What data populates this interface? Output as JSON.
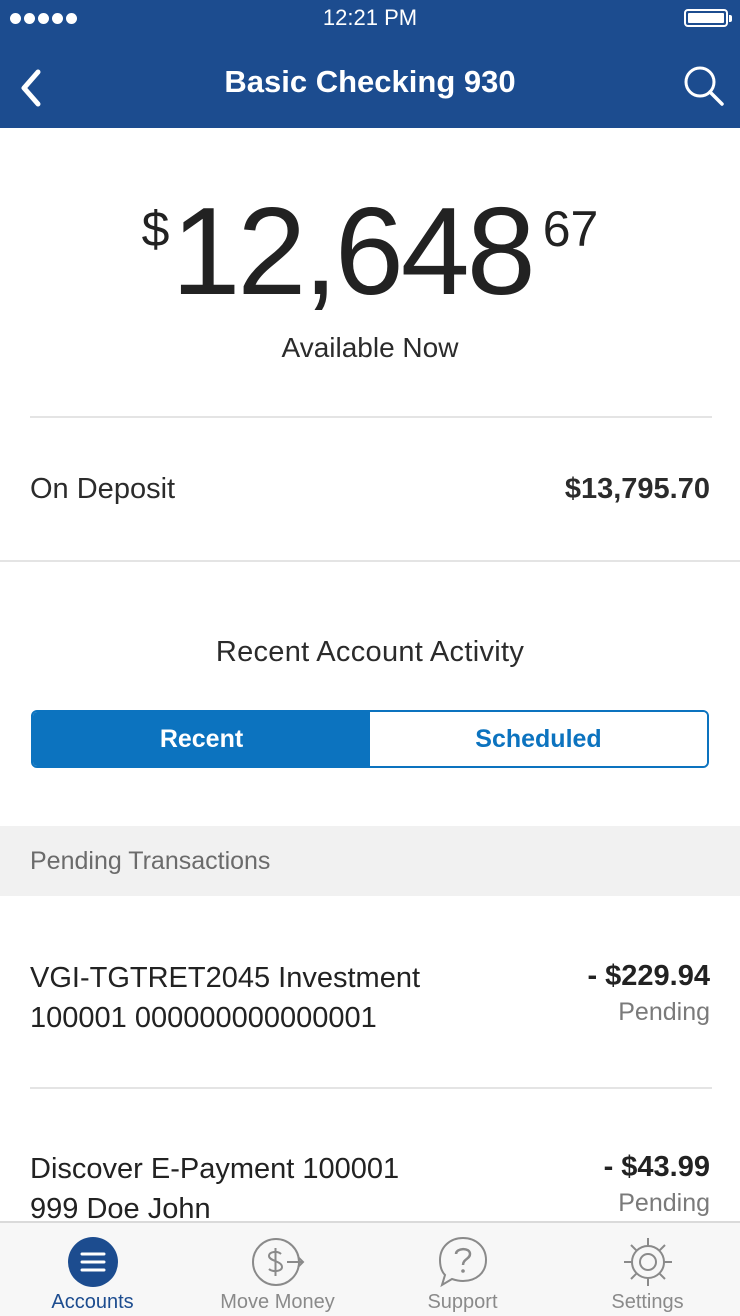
{
  "status_bar": {
    "time": "12:21 PM"
  },
  "header": {
    "title": "Basic Checking 930"
  },
  "balance": {
    "currency_symbol": "$",
    "whole": "12,648",
    "cents": "67",
    "label": "Available Now"
  },
  "on_deposit": {
    "label": "On Deposit",
    "value": "$13,795.70"
  },
  "activity": {
    "title": "Recent Account Activity",
    "tabs": [
      {
        "label": "Recent",
        "active": true
      },
      {
        "label": "Scheduled",
        "active": false
      }
    ]
  },
  "pending": {
    "section_label": "Pending Transactions",
    "transactions": [
      {
        "line1": "VGI-TGTRET2045 Investment",
        "line2": "100001 000000000000001",
        "amount": "- $229.94",
        "status": "Pending"
      },
      {
        "line1": "Discover E-Payment 100001",
        "line2": "999 Doe John",
        "amount": "- $43.99",
        "status": "Pending"
      }
    ]
  },
  "tabbar": {
    "items": [
      {
        "label": "Accounts",
        "icon": "menu-icon",
        "active": true
      },
      {
        "label": "Move Money",
        "icon": "transfer-dollar-icon",
        "active": false
      },
      {
        "label": "Support",
        "icon": "question-bubble-icon",
        "active": false
      },
      {
        "label": "Settings",
        "icon": "gear-icon",
        "active": false
      }
    ]
  },
  "colors": {
    "header_bg": "#1c4c8f",
    "accent": "#0c73bf",
    "tab_active": "#1c4c8f",
    "tab_inactive": "#8a8a8a"
  }
}
